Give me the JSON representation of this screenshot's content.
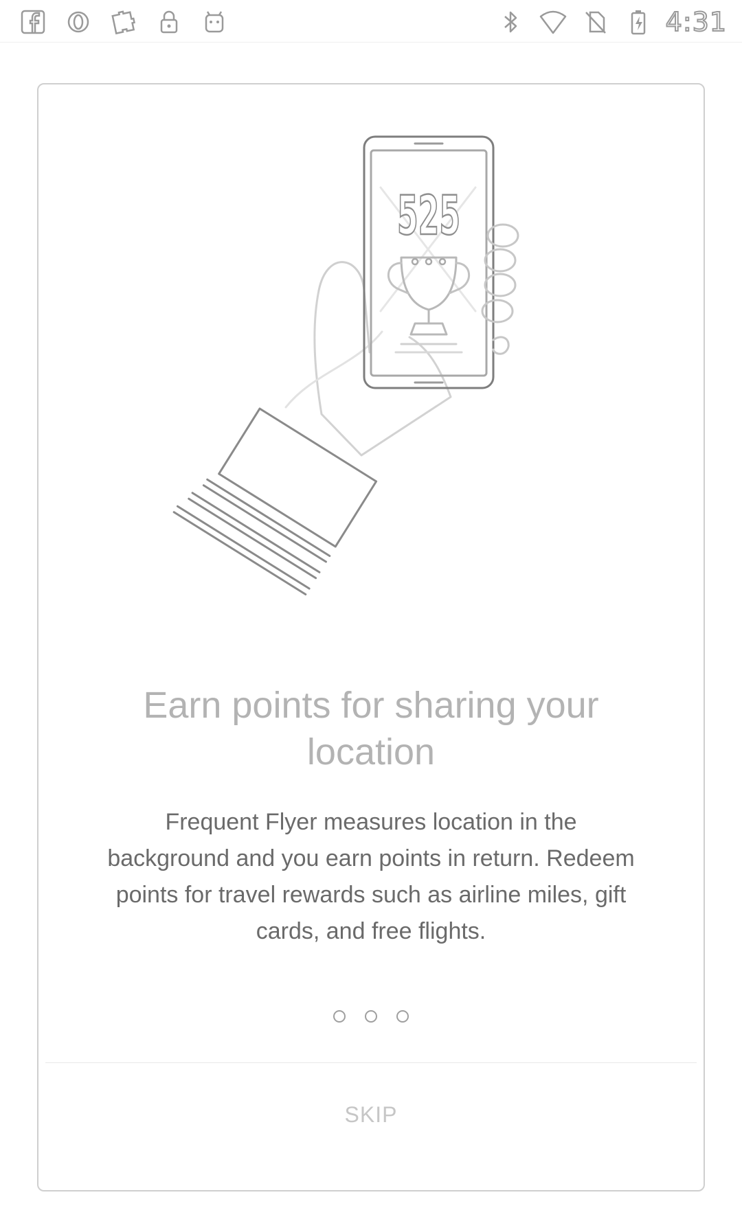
{
  "status_bar": {
    "time": "4:31",
    "left_icons": [
      "facebook-icon",
      "opera-icon",
      "puzzle-icon",
      "lock-icon",
      "android-icon"
    ],
    "right_icons": [
      "bluetooth-icon",
      "wifi-icon",
      "no-sim-icon",
      "battery-charging-icon"
    ]
  },
  "onboarding": {
    "illustration_number": "525",
    "title": "Earn points for sharing your location",
    "body": "Frequent Flyer measures location in the background and you earn points in return. Redeem points for travel rewards such as airline miles, gift cards, and free flights.",
    "page_count": 3,
    "skip_label": "SKIP"
  }
}
